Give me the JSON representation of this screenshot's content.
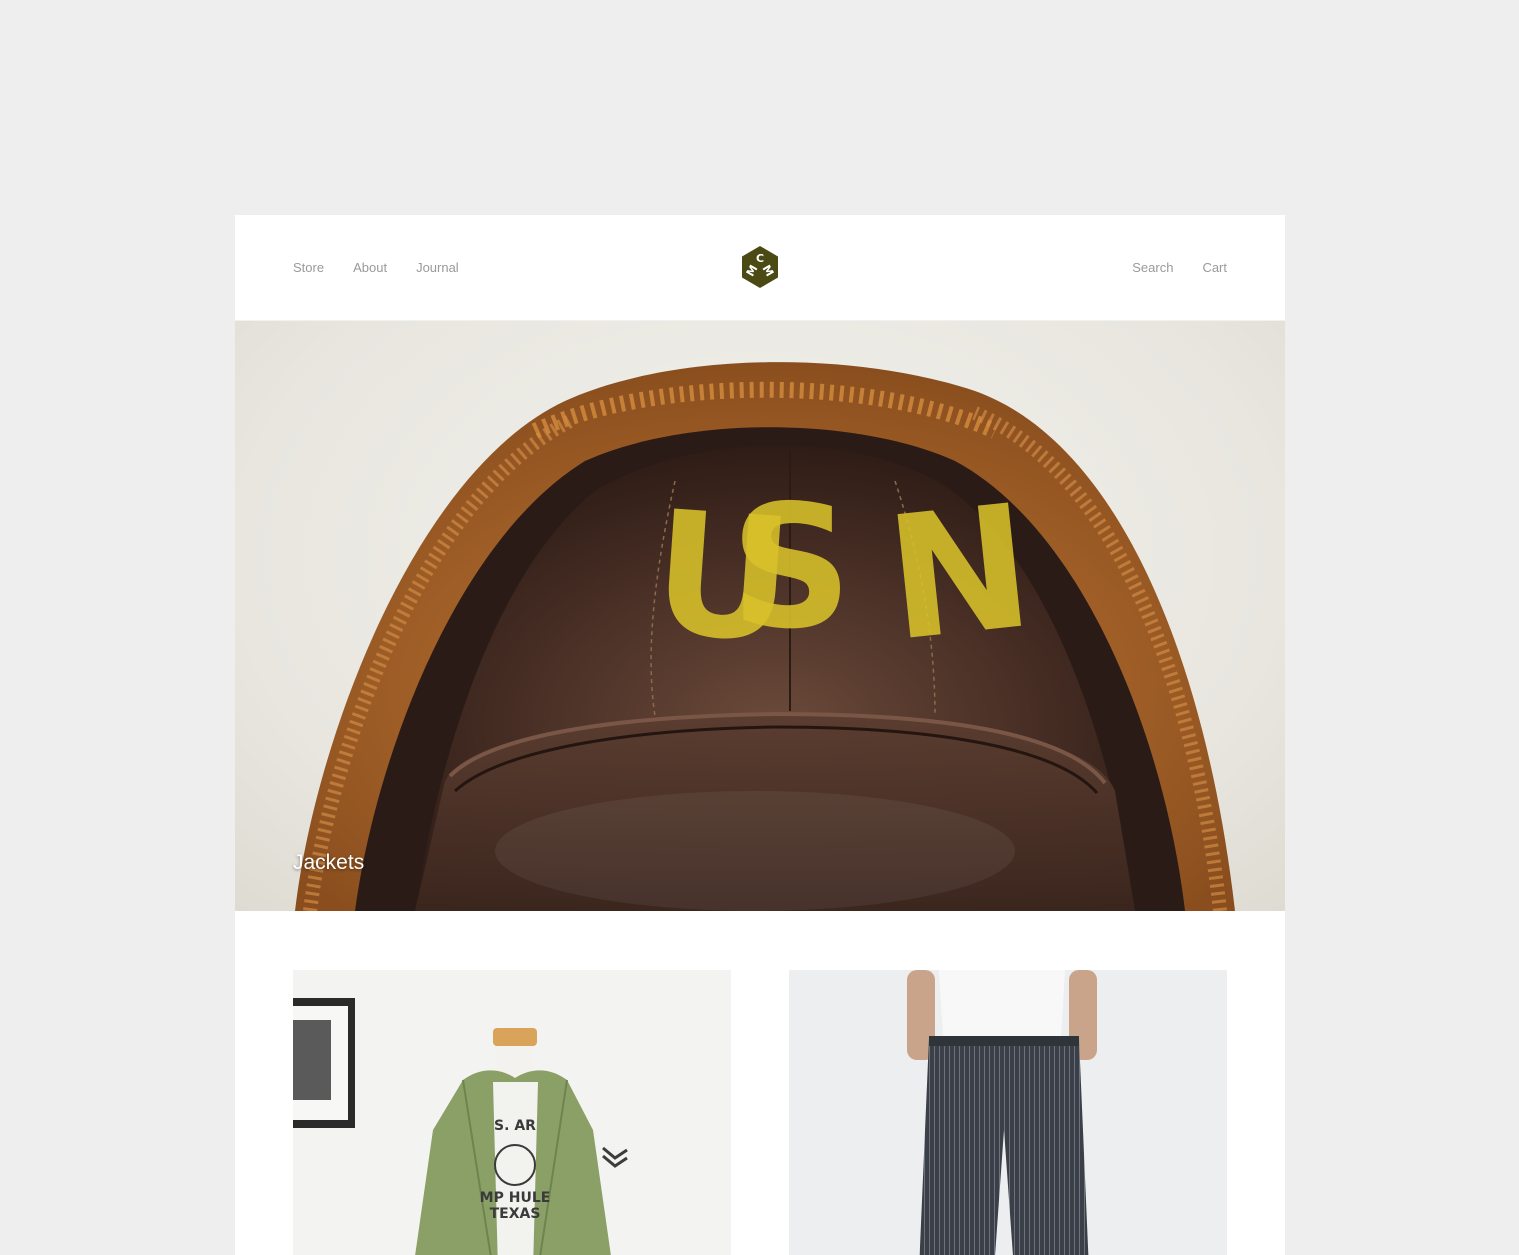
{
  "nav": {
    "left": [
      {
        "label": "Store"
      },
      {
        "label": "About"
      },
      {
        "label": "Journal"
      }
    ],
    "right": [
      {
        "label": "Search"
      },
      {
        "label": "Cart"
      }
    ]
  },
  "logo": {
    "letters": [
      "C",
      "M",
      "M"
    ],
    "color": "#4b4a14"
  },
  "hero": {
    "caption": "Jackets",
    "stencil": [
      "U",
      "S",
      "N"
    ],
    "stencil_color": "#d9c22a"
  },
  "products": [
    {
      "name": "green-army-jacket",
      "print_lines": [
        "S. AR",
        "MP HULE",
        "TEXAS"
      ]
    },
    {
      "name": "striped-trousers"
    }
  ]
}
